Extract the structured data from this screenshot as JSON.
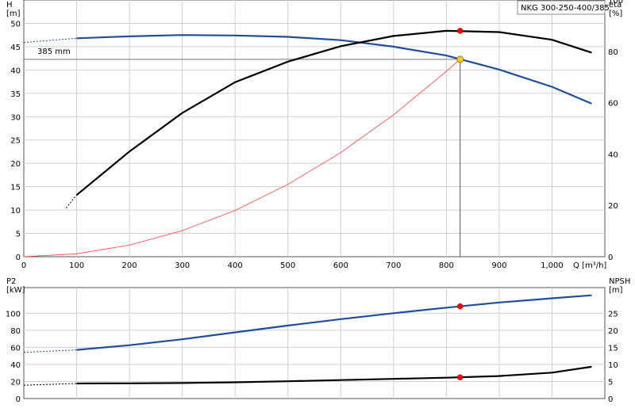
{
  "chart_data": [
    {
      "type": "line",
      "title": "NKG 300-250-400/385",
      "x_label": "Q [m³/h]",
      "x_ticks": [
        "0",
        "100",
        "200",
        "300",
        "400",
        "500",
        "600",
        "700",
        "800",
        "900",
        "1,000"
      ],
      "xlim": [
        0,
        1100
      ],
      "left_axis": {
        "label_top": "H",
        "label_unit": "[m]",
        "ylim": [
          0,
          55
        ],
        "ticks": [
          "0",
          "5",
          "10",
          "15",
          "20",
          "25",
          "30",
          "35",
          "40",
          "45",
          "50"
        ]
      },
      "right_axis": {
        "label_top": "eta",
        "label_unit": "[%]",
        "ylim": [
          0,
          100
        ],
        "ticks": [
          "0",
          "20",
          "40",
          "60",
          "80",
          "100"
        ]
      },
      "grid": true,
      "annotations": [
        {
          "text": "385 mm"
        }
      ],
      "duty_point": {
        "q": 826,
        "h": 42.3,
        "eta": 88
      },
      "series": [
        {
          "key": "head",
          "axis": "left",
          "color": "#1f4e9a",
          "style": "solid",
          "x": [
            100,
            200,
            300,
            400,
            500,
            600,
            700,
            800,
            900,
            1000,
            1075
          ],
          "y": [
            46.8,
            47.2,
            47.5,
            47.4,
            47.1,
            46.4,
            45.0,
            43.1,
            40.1,
            36.4,
            32.8
          ]
        },
        {
          "key": "head-extrapolated",
          "axis": "left",
          "color": "#1f4e9a",
          "style": "dashed",
          "x": [
            0,
            100
          ],
          "y": [
            45.9,
            46.8
          ]
        },
        {
          "key": "efficiency",
          "axis": "right",
          "color": "#000000",
          "style": "solid",
          "x": [
            100,
            200,
            300,
            400,
            500,
            600,
            700,
            800,
            900,
            1000,
            1075
          ],
          "y": [
            24,
            41,
            56,
            68,
            76,
            82,
            86,
            88,
            87.5,
            84.5,
            79.5
          ]
        },
        {
          "key": "efficiency-extrapolated",
          "axis": "right",
          "color": "#000000",
          "style": "dashed",
          "x": [
            80,
            100
          ],
          "y": [
            19,
            24
          ]
        },
        {
          "key": "system-curve",
          "axis": "left",
          "color": "#ff3b3b",
          "style": "thin",
          "x": [
            0,
            100,
            200,
            300,
            400,
            500,
            600,
            700,
            800,
            826
          ],
          "y": [
            0,
            0.62,
            2.48,
            5.58,
            9.92,
            15.5,
            22.3,
            30.4,
            39.7,
            42.3
          ]
        }
      ]
    },
    {
      "type": "line",
      "x_label": "",
      "xlim": [
        0,
        1100
      ],
      "left_axis": {
        "label_top": "P2",
        "label_unit": "[kW]",
        "ylim": [
          0,
          130
        ],
        "ticks": [
          "0",
          "20",
          "40",
          "60",
          "80",
          "100"
        ]
      },
      "right_axis": {
        "label_top": "NPSH",
        "label_unit": "[m]",
        "ylim": [
          0,
          32.5
        ],
        "ticks": [
          "0",
          "5",
          "10",
          "15",
          "20",
          "25"
        ]
      },
      "grid": true,
      "duty_point": {
        "q": 826,
        "p2": 108,
        "npsh": 6.2
      },
      "series": [
        {
          "key": "power",
          "axis": "left",
          "color": "#1f4e9a",
          "style": "solid",
          "x": [
            100,
            200,
            300,
            400,
            500,
            600,
            700,
            800,
            900,
            1000,
            1075
          ],
          "y": [
            57,
            62.5,
            69.5,
            77.5,
            85.5,
            93,
            100,
            106.5,
            112.5,
            117.5,
            121
          ]
        },
        {
          "key": "power-extrapolated",
          "axis": "left",
          "color": "#1f4e9a",
          "style": "dashed",
          "x": [
            0,
            100
          ],
          "y": [
            54,
            57
          ]
        },
        {
          "key": "npsh",
          "axis": "right",
          "color": "#000000",
          "style": "solid",
          "x": [
            100,
            200,
            300,
            400,
            500,
            600,
            700,
            800,
            900,
            1000,
            1075
          ],
          "y": [
            4.4,
            4.45,
            4.55,
            4.75,
            5.05,
            5.4,
            5.75,
            6.1,
            6.6,
            7.6,
            9.3
          ]
        },
        {
          "key": "npsh-extrapolated",
          "axis": "right",
          "color": "#000000",
          "style": "dashed",
          "x": [
            0,
            100
          ],
          "y": [
            3.9,
            4.4
          ]
        }
      ]
    }
  ]
}
